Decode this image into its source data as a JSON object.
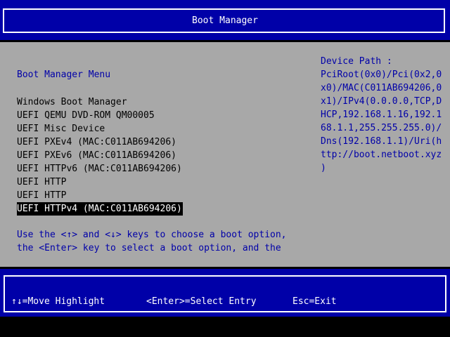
{
  "header": {
    "title": "Boot Manager"
  },
  "menu": {
    "title": "Boot Manager Menu",
    "items": [
      {
        "label": "Windows Boot Manager"
      },
      {
        "label": "UEFI QEMU DVD-ROM QM00005"
      },
      {
        "label": "UEFI Misc Device"
      },
      {
        "label": "UEFI PXEv4 (MAC:C011AB694206)"
      },
      {
        "label": "UEFI PXEv6 (MAC:C011AB694206)"
      },
      {
        "label": "UEFI HTTPv6 (MAC:C011AB694206)"
      },
      {
        "label": "UEFI HTTP"
      },
      {
        "label": "UEFI HTTP"
      },
      {
        "label": "UEFI HTTPv4 (MAC:C011AB694206)",
        "selected": true
      }
    ],
    "help_lines": [
      "Use the <↑> and <↓> keys to choose a boot option,",
      "the <Enter> key to select a boot option, and the"
    ]
  },
  "device_path": {
    "title": "Device Path :",
    "lines": [
      "PciRoot(0x0)/Pci(0x2,0",
      "x0)/MAC(C011AB694206,0",
      "x1)/IPv4(0.0.0.0,TCP,D",
      "HCP,192.168.1.16,192.1",
      "68.1.1,255.255.255.0)/",
      "Dns(192.168.1.1)/Uri(h",
      "ttp://boot.netboot.xyz",
      ")"
    ]
  },
  "footer": {
    "move": "↑↓=Move Highlight",
    "select": "<Enter>=Select Entry",
    "exit": "Esc=Exit"
  },
  "colors": {
    "band_blue": "#0000a8",
    "body_gray": "#a8a8a8",
    "text_blue": "#0000a8",
    "highlight": "#000000"
  }
}
